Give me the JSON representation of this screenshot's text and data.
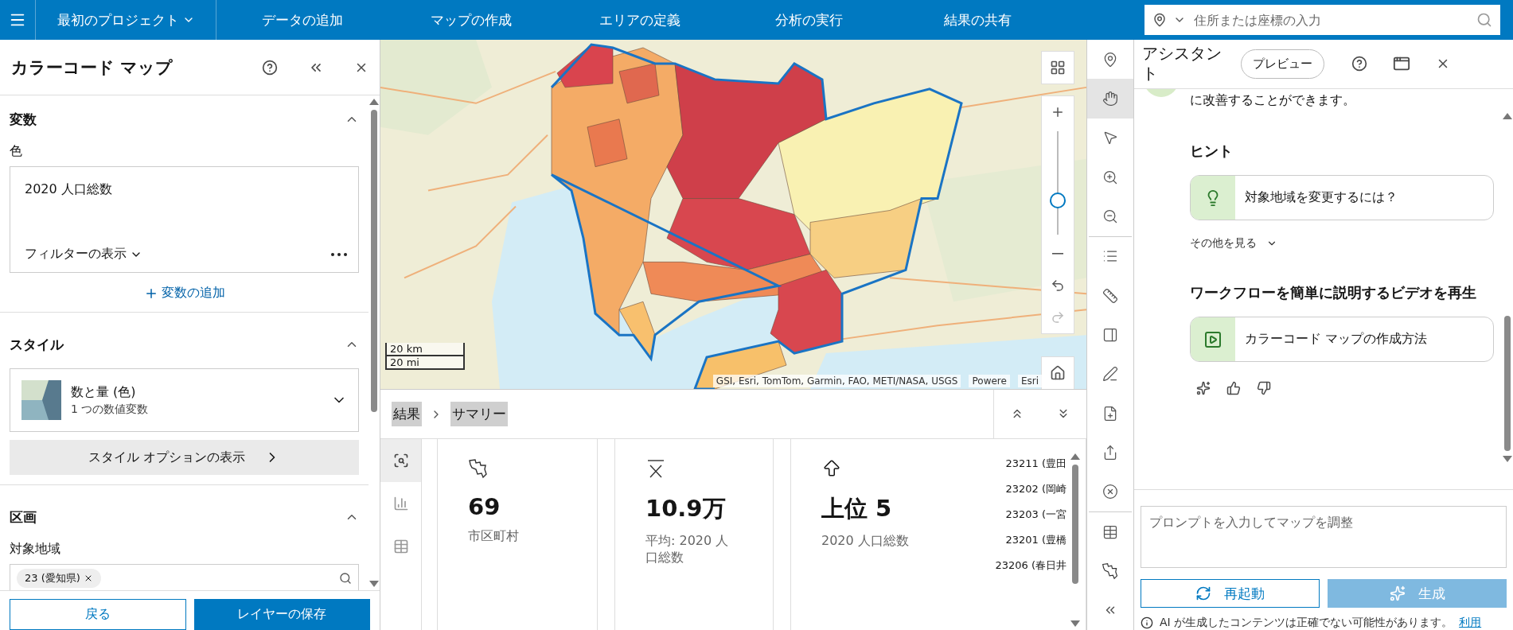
{
  "top_bar": {
    "project": "最初のプロジェクト",
    "nav": [
      "データの追加",
      "マップの作成",
      "エリアの定義",
      "分析の実行",
      "結果の共有"
    ],
    "search": {
      "placeholder": "住所または座標の入力"
    }
  },
  "left_panel": {
    "title": "カラーコード マップ",
    "variables_section": {
      "title": "変数",
      "expanded": true,
      "color_label": "色",
      "variable": "2020 人口総数",
      "filter_toggle": "フィルターの表示",
      "add_variable": "変数の追加"
    },
    "style_section": {
      "title": "スタイル",
      "expanded": true,
      "style_name": "数と量 (色)",
      "style_description": "1 つの数値変数",
      "options_button": "スタイル オプションの表示"
    },
    "area_section": {
      "title": "区画",
      "expanded": true,
      "label": "対象地域",
      "chips": [
        "23 (愛知県)"
      ]
    },
    "footer": {
      "back": "戻る",
      "save": "レイヤーの保存"
    }
  },
  "map": {
    "scale": [
      "20 km",
      "20 mi"
    ],
    "attribution": "GSI, Esri, TomTom, Garmin, FAO, METI/NASA, USGS",
    "powered": "Powere",
    "powered_tail": "Esri",
    "zoom": {
      "level": 0.3
    }
  },
  "results": {
    "crumbs": [
      "結果",
      "サマリー"
    ],
    "side_tabs": [
      {
        "selected": true
      },
      {
        "selected": false
      },
      {
        "selected": false
      }
    ],
    "cards": [
      {
        "kind": "count",
        "value": "69",
        "label": "市区町村"
      },
      {
        "kind": "mean",
        "value": "10.9万",
        "label": "平均: 2020 人口総数"
      },
      {
        "kind": "top",
        "value": "上位 5",
        "label": "2020 人口総数",
        "items": [
          "23211 (豊田",
          "23202 (岡崎",
          "23203 (一宮",
          "23201 (豊橋",
          "23206 (春日井"
        ]
      }
    ]
  },
  "tools": [
    {
      "selected": false
    },
    {
      "selected": true
    },
    {
      "selected": false
    },
    {
      "selected": false
    },
    {
      "selected": false
    },
    {
      "selected": false
    },
    {
      "selected": false
    },
    {
      "selected": false
    },
    {
      "selected": false
    },
    {
      "selected": false
    },
    {
      "selected": false
    },
    {
      "selected": false
    },
    {
      "selected": false
    },
    {
      "selected": false
    }
  ],
  "assistant": {
    "title": "アシスタント",
    "badge": "プレビュー",
    "message_tail": "に改善することができます。",
    "hint_heading": "ヒント",
    "hints": [
      "対象地域を変更するには？"
    ],
    "more": "その他を見る",
    "video_heading": "ワークフローを簡単に説明するビデオを再生",
    "videos": [
      "カラーコード マップの作成方法"
    ],
    "prompt": {
      "placeholder": "プロンプトを入力してマップを調整"
    },
    "buttons": [
      {
        "kind": "restart",
        "label": "再起動",
        "disabled": false
      },
      {
        "kind": "generate",
        "label": "生成",
        "disabled": true
      }
    ],
    "disclaimer": "AI が生成したコンテンツは正確でない可能性があります。",
    "disclaimer_link": "利用"
  }
}
